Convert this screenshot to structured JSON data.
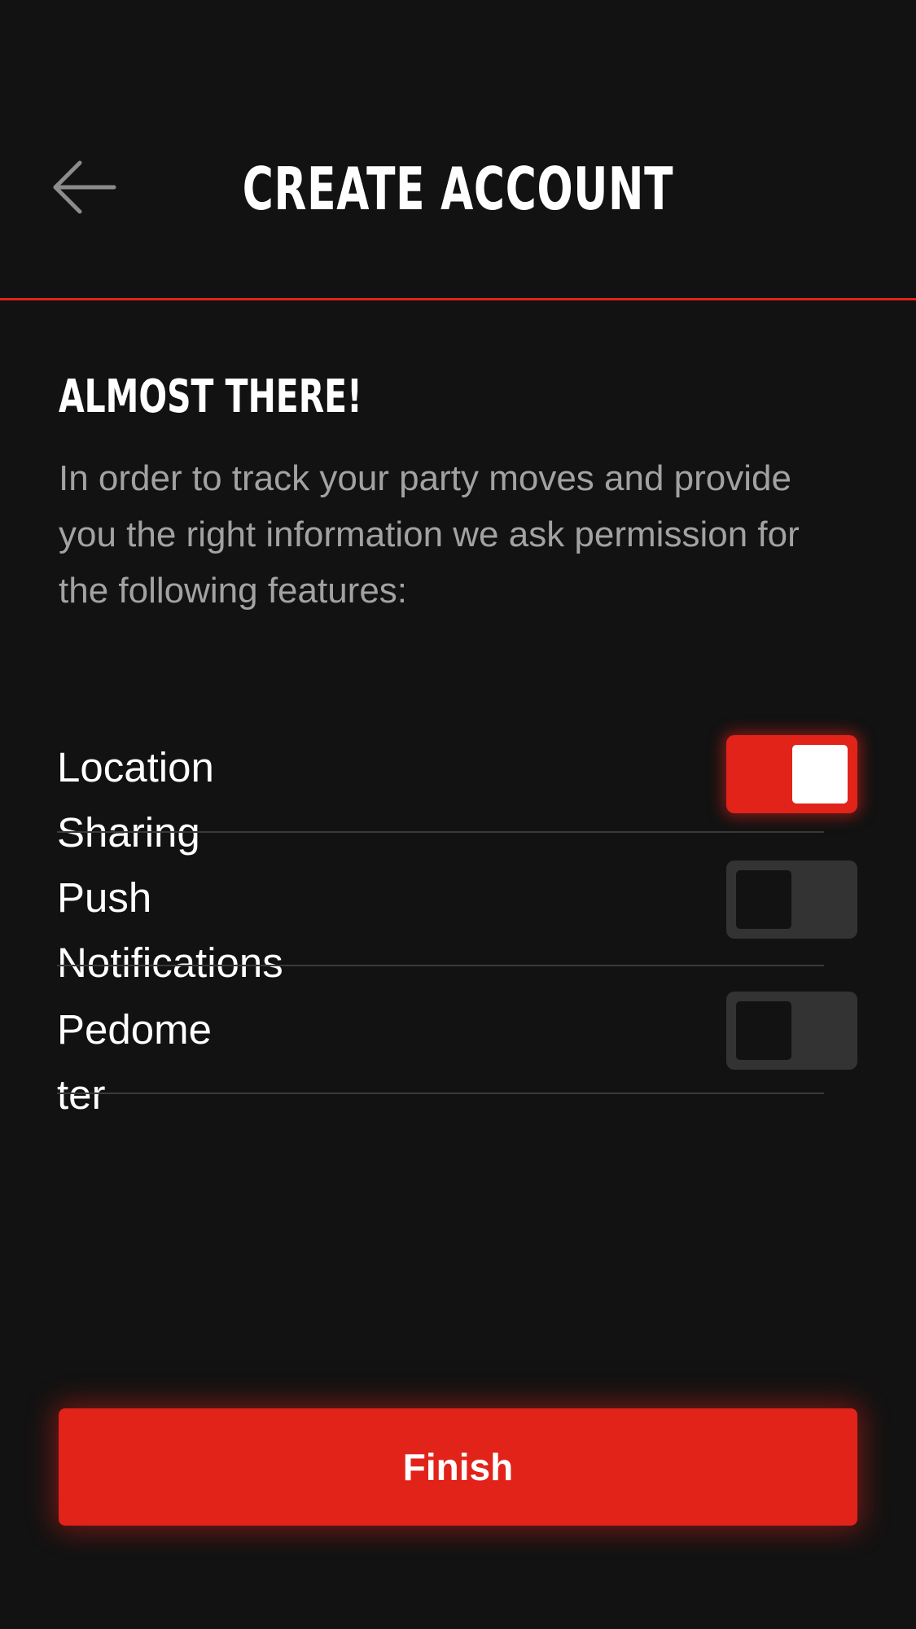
{
  "header": {
    "title": "CREATE ACCOUNT",
    "back_icon": "arrow-left-icon"
  },
  "main": {
    "heading": "ALMOST THERE!",
    "description": "In order to track your party moves and provide you the right information we ask permission for the following features:",
    "permissions": [
      {
        "label": "Location\nSharing",
        "enabled": true
      },
      {
        "label": "Push\nNotifications",
        "enabled": false
      },
      {
        "label": "Pedome\nter",
        "enabled": false
      }
    ]
  },
  "footer": {
    "finish_label": "Finish"
  },
  "colors": {
    "accent": "#e2231a",
    "background": "#121212",
    "toggle_off": "#333333",
    "muted_text": "#a2a2a2"
  }
}
